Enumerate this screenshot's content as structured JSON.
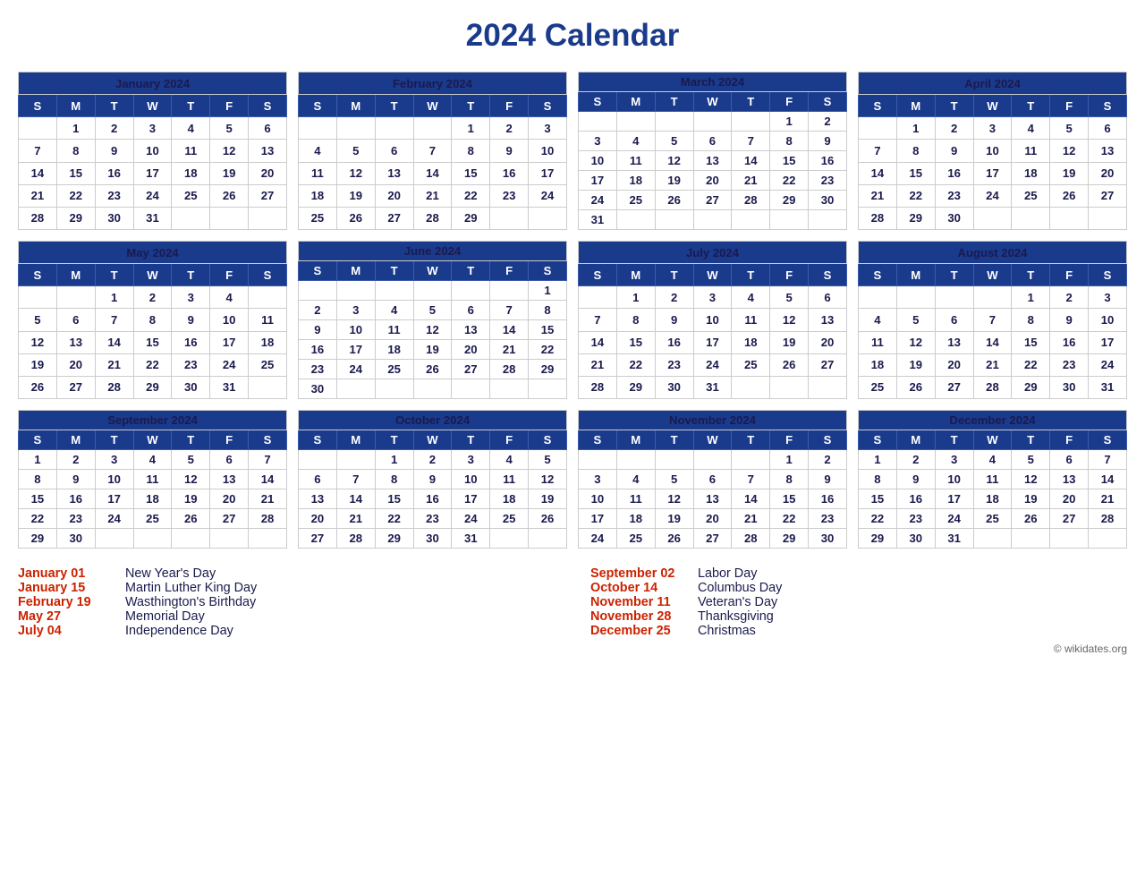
{
  "title": "2024 Calendar",
  "months": [
    {
      "name": "January 2024",
      "days_header": [
        "S",
        "M",
        "T",
        "W",
        "T",
        "F",
        "S"
      ],
      "weeks": [
        [
          "",
          "1",
          "2",
          "3",
          "4",
          "5",
          "6"
        ],
        [
          "7",
          "8",
          "9",
          "10",
          "11",
          "12",
          "13"
        ],
        [
          "14",
          "15",
          "16",
          "17",
          "18",
          "19",
          "20"
        ],
        [
          "21",
          "22",
          "23",
          "24",
          "25",
          "26",
          "27"
        ],
        [
          "28",
          "29",
          "30",
          "31",
          "",
          "",
          ""
        ]
      ],
      "red_days": [
        "1",
        "15"
      ]
    },
    {
      "name": "February 2024",
      "days_header": [
        "S",
        "M",
        "T",
        "W",
        "T",
        "F",
        "S"
      ],
      "weeks": [
        [
          "",
          "",
          "",
          "",
          "1",
          "2",
          "3"
        ],
        [
          "4",
          "5",
          "6",
          "7",
          "8",
          "9",
          "10"
        ],
        [
          "11",
          "12",
          "13",
          "14",
          "15",
          "16",
          "17"
        ],
        [
          "18",
          "19",
          "20",
          "21",
          "22",
          "23",
          "24"
        ],
        [
          "25",
          "26",
          "27",
          "28",
          "29",
          "",
          ""
        ]
      ],
      "red_days": [
        "19"
      ]
    },
    {
      "name": "March 2024",
      "days_header": [
        "S",
        "M",
        "T",
        "W",
        "T",
        "F",
        "S"
      ],
      "weeks": [
        [
          "",
          "",
          "",
          "",
          "",
          "1",
          "2"
        ],
        [
          "3",
          "4",
          "5",
          "6",
          "7",
          "8",
          "9"
        ],
        [
          "10",
          "11",
          "12",
          "13",
          "14",
          "15",
          "16"
        ],
        [
          "17",
          "18",
          "19",
          "20",
          "21",
          "22",
          "23"
        ],
        [
          "24",
          "25",
          "26",
          "27",
          "28",
          "29",
          "30"
        ],
        [
          "31",
          "",
          "",
          "",
          "",
          "",
          ""
        ]
      ],
      "red_days": []
    },
    {
      "name": "April 2024",
      "days_header": [
        "S",
        "M",
        "T",
        "W",
        "T",
        "F",
        "S"
      ],
      "weeks": [
        [
          "",
          "1",
          "2",
          "3",
          "4",
          "5",
          "6"
        ],
        [
          "7",
          "8",
          "9",
          "10",
          "11",
          "12",
          "13"
        ],
        [
          "14",
          "15",
          "16",
          "17",
          "18",
          "19",
          "20"
        ],
        [
          "21",
          "22",
          "23",
          "24",
          "25",
          "26",
          "27"
        ],
        [
          "28",
          "29",
          "30",
          "",
          "",
          "",
          ""
        ]
      ],
      "red_days": []
    },
    {
      "name": "May 2024",
      "days_header": [
        "S",
        "M",
        "T",
        "W",
        "T",
        "F",
        "S"
      ],
      "weeks": [
        [
          "",
          "",
          "1",
          "2",
          "3",
          "4",
          ""
        ],
        [
          "5",
          "6",
          "7",
          "8",
          "9",
          "10",
          "11"
        ],
        [
          "12",
          "13",
          "14",
          "15",
          "16",
          "17",
          "18"
        ],
        [
          "19",
          "20",
          "21",
          "22",
          "23",
          "24",
          "25"
        ],
        [
          "26",
          "27",
          "28",
          "29",
          "30",
          "31",
          ""
        ]
      ],
      "red_days": [
        "27"
      ]
    },
    {
      "name": "June 2024",
      "days_header": [
        "S",
        "M",
        "T",
        "W",
        "T",
        "F",
        "S"
      ],
      "weeks": [
        [
          "",
          "",
          "",
          "",
          "",
          "",
          "1"
        ],
        [
          "2",
          "3",
          "4",
          "5",
          "6",
          "7",
          "8"
        ],
        [
          "9",
          "10",
          "11",
          "12",
          "13",
          "14",
          "15"
        ],
        [
          "16",
          "17",
          "18",
          "19",
          "20",
          "21",
          "22"
        ],
        [
          "23",
          "24",
          "25",
          "26",
          "27",
          "28",
          "29"
        ],
        [
          "30",
          "",
          "",
          "",
          "",
          "",
          ""
        ]
      ],
      "red_days": []
    },
    {
      "name": "July 2024",
      "days_header": [
        "S",
        "M",
        "T",
        "W",
        "T",
        "F",
        "S"
      ],
      "weeks": [
        [
          "",
          "1",
          "2",
          "3",
          "4",
          "5",
          "6"
        ],
        [
          "7",
          "8",
          "9",
          "10",
          "11",
          "12",
          "13"
        ],
        [
          "14",
          "15",
          "16",
          "17",
          "18",
          "19",
          "20"
        ],
        [
          "21",
          "22",
          "23",
          "24",
          "25",
          "26",
          "27"
        ],
        [
          "28",
          "29",
          "30",
          "31",
          "",
          "",
          ""
        ]
      ],
      "red_days": [
        "4"
      ]
    },
    {
      "name": "August 2024",
      "days_header": [
        "S",
        "M",
        "T",
        "W",
        "T",
        "F",
        "S"
      ],
      "weeks": [
        [
          "",
          "",
          "",
          "",
          "1",
          "2",
          "3"
        ],
        [
          "4",
          "5",
          "6",
          "7",
          "8",
          "9",
          "10"
        ],
        [
          "11",
          "12",
          "13",
          "14",
          "15",
          "16",
          "17"
        ],
        [
          "18",
          "19",
          "20",
          "21",
          "22",
          "23",
          "24"
        ],
        [
          "25",
          "26",
          "27",
          "28",
          "29",
          "30",
          "31"
        ]
      ],
      "red_days": []
    },
    {
      "name": "September 2024",
      "days_header": [
        "S",
        "M",
        "T",
        "W",
        "T",
        "F",
        "S"
      ],
      "weeks": [
        [
          "1",
          "2",
          "3",
          "4",
          "5",
          "6",
          "7"
        ],
        [
          "8",
          "9",
          "10",
          "11",
          "12",
          "13",
          "14"
        ],
        [
          "15",
          "16",
          "17",
          "18",
          "19",
          "20",
          "21"
        ],
        [
          "22",
          "23",
          "24",
          "25",
          "26",
          "27",
          "28"
        ],
        [
          "29",
          "30",
          "",
          "",
          "",
          "",
          ""
        ]
      ],
      "red_days": [
        "2"
      ]
    },
    {
      "name": "October 2024",
      "days_header": [
        "S",
        "M",
        "T",
        "W",
        "T",
        "F",
        "S"
      ],
      "weeks": [
        [
          "",
          "",
          "1",
          "2",
          "3",
          "4",
          "5"
        ],
        [
          "6",
          "7",
          "8",
          "9",
          "10",
          "11",
          "12"
        ],
        [
          "13",
          "14",
          "15",
          "16",
          "17",
          "18",
          "19"
        ],
        [
          "20",
          "21",
          "22",
          "23",
          "24",
          "25",
          "26"
        ],
        [
          "27",
          "28",
          "29",
          "30",
          "31",
          "",
          ""
        ]
      ],
      "red_days": [
        "14"
      ]
    },
    {
      "name": "November 2024",
      "days_header": [
        "S",
        "M",
        "T",
        "W",
        "T",
        "F",
        "S"
      ],
      "weeks": [
        [
          "",
          "",
          "",
          "",
          "",
          "1",
          "2"
        ],
        [
          "3",
          "4",
          "5",
          "6",
          "7",
          "8",
          "9"
        ],
        [
          "10",
          "11",
          "12",
          "13",
          "14",
          "15",
          "16"
        ],
        [
          "17",
          "18",
          "19",
          "20",
          "21",
          "22",
          "23"
        ],
        [
          "24",
          "25",
          "26",
          "27",
          "28",
          "29",
          "30"
        ]
      ],
      "red_days": [
        "11",
        "28"
      ]
    },
    {
      "name": "December 2024",
      "days_header": [
        "S",
        "M",
        "T",
        "W",
        "T",
        "F",
        "S"
      ],
      "weeks": [
        [
          "1",
          "2",
          "3",
          "4",
          "5",
          "6",
          "7"
        ],
        [
          "8",
          "9",
          "10",
          "11",
          "12",
          "13",
          "14"
        ],
        [
          "15",
          "16",
          "17",
          "18",
          "19",
          "20",
          "21"
        ],
        [
          "22",
          "23",
          "24",
          "25",
          "26",
          "27",
          "28"
        ],
        [
          "29",
          "30",
          "31",
          "",
          "",
          "",
          ""
        ]
      ],
      "red_days": [
        "25"
      ]
    }
  ],
  "holidays": [
    {
      "date": "January 01",
      "name": "New Year's Day"
    },
    {
      "date": "January 15",
      "name": "Martin Luther King Day"
    },
    {
      "date": "February 19",
      "name": "Wasthington's Birthday"
    },
    {
      "date": "May 27",
      "name": "Memorial Day"
    },
    {
      "date": "July 04",
      "name": "Independence Day"
    },
    {
      "date": "September 02",
      "name": "Labor Day"
    },
    {
      "date": "October 14",
      "name": "Columbus Day"
    },
    {
      "date": "November 11",
      "name": "Veteran's Day"
    },
    {
      "date": "November 28",
      "name": "Thanksgiving"
    },
    {
      "date": "December 25",
      "name": "Christmas"
    }
  ],
  "copyright": "© wikidates.org"
}
